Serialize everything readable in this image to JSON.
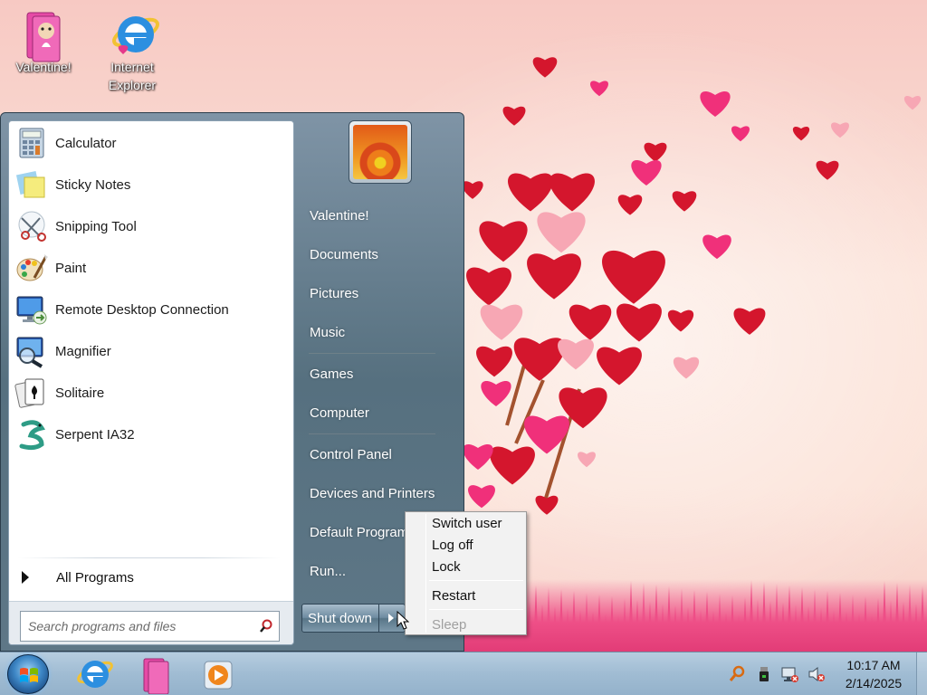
{
  "desktop": {
    "icons": [
      {
        "label": "Valentine!",
        "icon": "valentine-folder-icon"
      },
      {
        "label": "Internet\nExplorer",
        "icon": "internet-explorer-icon"
      }
    ]
  },
  "start_menu": {
    "programs": [
      {
        "label": "Calculator",
        "icon": "calculator-icon"
      },
      {
        "label": "Sticky Notes",
        "icon": "sticky-notes-icon"
      },
      {
        "label": "Snipping Tool",
        "icon": "scissors-icon"
      },
      {
        "label": "Paint",
        "icon": "paint-palette-icon"
      },
      {
        "label": "Remote Desktop Connection",
        "icon": "remote-desktop-icon"
      },
      {
        "label": "Magnifier",
        "icon": "magnifier-icon"
      },
      {
        "label": "Solitaire",
        "icon": "cards-icon"
      },
      {
        "label": "Serpent IA32",
        "icon": "serpent-icon"
      }
    ],
    "all_programs": "All Programs",
    "search_placeholder": "Search programs and files",
    "right_items": [
      {
        "label": "Valentine!"
      },
      {
        "label": "Documents"
      },
      {
        "label": "Pictures"
      },
      {
        "label": "Music"
      },
      {
        "label": "Games"
      },
      {
        "label": "Computer"
      },
      {
        "label": "Control Panel"
      },
      {
        "label": "Devices and Printers"
      },
      {
        "label": "Default Programs"
      },
      {
        "label": "Run..."
      }
    ],
    "shutdown_label": "Shut down"
  },
  "power_menu": {
    "items": [
      {
        "label": "Switch user",
        "enabled": true
      },
      {
        "label": "Log off",
        "enabled": true
      },
      {
        "label": "Lock",
        "enabled": true
      },
      {
        "label": "Restart",
        "enabled": true
      },
      {
        "label": "Sleep",
        "enabled": false
      }
    ]
  },
  "taskbar": {
    "pinned": [
      {
        "icon": "internet-explorer-icon"
      },
      {
        "icon": "valentine-folder-icon"
      },
      {
        "icon": "media-player-icon"
      }
    ],
    "tray": [
      {
        "icon": "search-key-icon"
      },
      {
        "icon": "usb-device-icon"
      },
      {
        "icon": "network-icon"
      },
      {
        "icon": "volume-muted-icon"
      }
    ],
    "time": "10:17 AM",
    "date": "2/14/2025"
  },
  "colors": {
    "heart_red": "#d4162d",
    "heart_pink": "#f0307a",
    "heart_light": "#f7a7b4",
    "menu_blue": "#56707f"
  }
}
